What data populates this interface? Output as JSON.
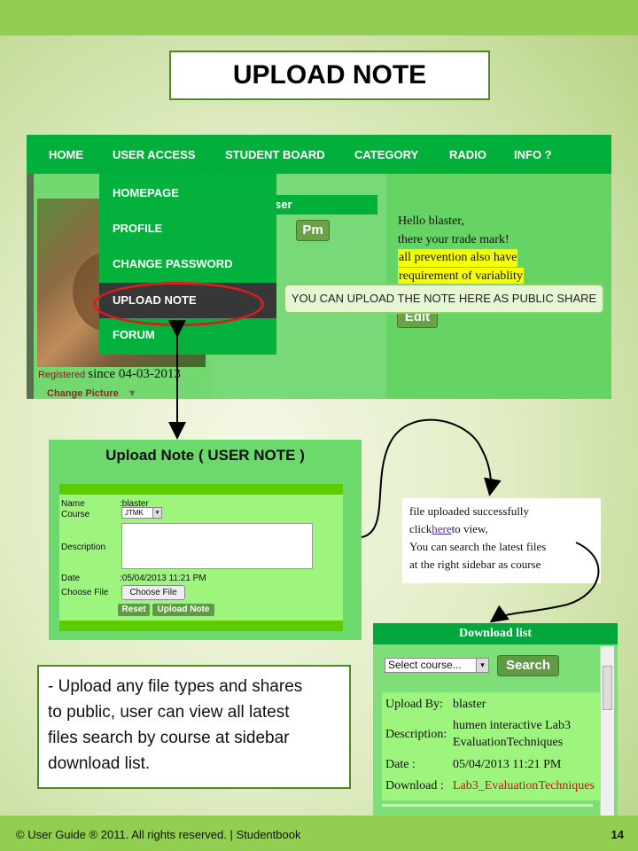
{
  "title": "UPLOAD NOTE",
  "nav": {
    "items": [
      "HOME",
      "USER ACCESS",
      "STUDENT BOARD",
      "CATEGORY",
      "RADIO",
      "INFO ?"
    ]
  },
  "dropdown": {
    "items": [
      "HOMEPAGE",
      "PROFILE",
      "CHANGE PASSWORD",
      "UPLOAD NOTE",
      "FORUM"
    ]
  },
  "profile": {
    "registered_label": "Registered",
    "since_text": "since 04-03-2013",
    "change_picture": "Change Picture",
    "caret": "▼",
    "panel_header": "ser",
    "pm_button": "Pm",
    "hello_line1": "Hello blaster,",
    "hello_line2": "there your trade mark!",
    "highlight1": "all prevention also have",
    "highlight2": "requirement of variablity",
    "edit_button": "Edit"
  },
  "callout": "YOU CAN UPLOAD THE NOTE HERE AS PUBLIC SHARE",
  "upload_form": {
    "heading": "Upload Note ( USER NOTE )",
    "name_label": "Name",
    "name_value": ":blaster",
    "course_label": "Course",
    "course_value": "JTMK",
    "description_label": "Description",
    "date_label": "Date",
    "date_value": ":05/04/2013 11:21 PM",
    "choose_file_label": "Choose File",
    "choose_file_button": "Choose File",
    "reset_button": "Reset",
    "upload_button": "Upload Note"
  },
  "success": {
    "line1": "file uploaded successfully",
    "click_prefix": "click",
    "link": "here",
    "click_suffix": "to view,",
    "line3": "You can search the latest files",
    "line4": "at the right sidebar as course"
  },
  "download_list": {
    "header": "Download list",
    "select_placeholder": "Select course...",
    "search_button": "Search",
    "upload_by_label": "Upload By:",
    "upload_by_value": "blaster",
    "description_label": "Description:",
    "description_line1": "humen interactive Lab3",
    "description_line2": "EvaluationTechniques",
    "date_label": "Date :",
    "date_value": "05/04/2013 11:21 PM",
    "download_label": "Download :",
    "download_value": "Lab3_EvaluationTechniques"
  },
  "note": {
    "line1": "- Upload any file types and shares",
    "line2": "to public, user can view all latest",
    "line3": "files search by course at sidebar",
    "line4": "download list."
  },
  "footer": {
    "copyright": "© User Guide ® 2011. All rights reserved. | Studentbook",
    "page_number": "14"
  },
  "colors": {
    "nav_green": "#00b03b",
    "highlight_yellow": "#f6ff00",
    "ellipse_red": "#d81e1e",
    "footer_green": "#92cf50"
  }
}
